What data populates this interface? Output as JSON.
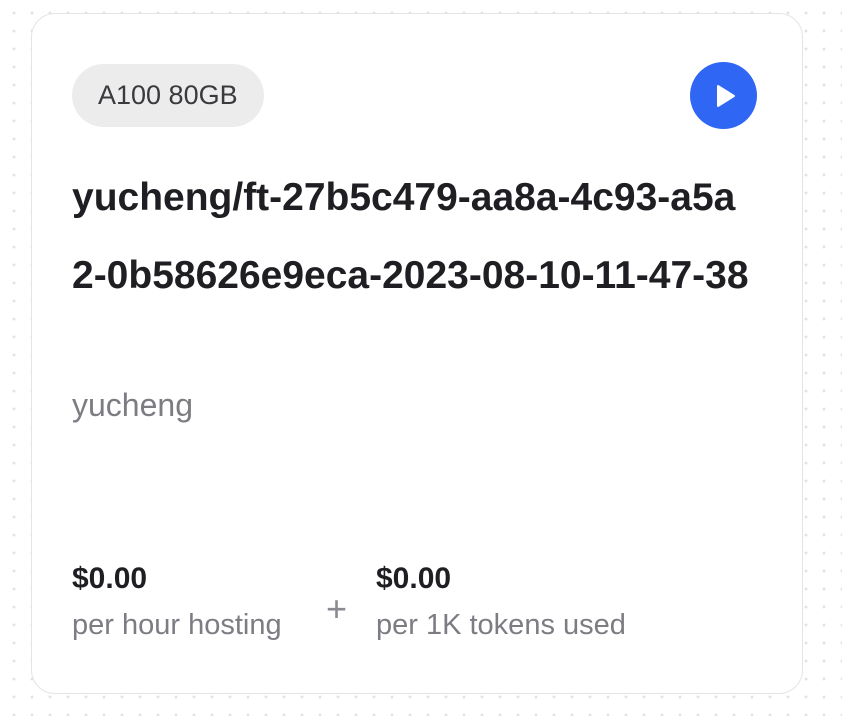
{
  "card": {
    "badge": "A100 80GB",
    "title": "yucheng/ft-27b5c479-aa8a-4c93-a5a2-0b58626e9eca-2023-08-10-11-47-38",
    "owner": "yucheng",
    "play_icon": "play-icon",
    "pricing": {
      "hosting": {
        "amount": "$0.00",
        "description": "per hour hosting"
      },
      "separator": "+",
      "tokens": {
        "amount": "$0.00",
        "description": "per 1K tokens used"
      }
    }
  },
  "colors": {
    "accent": "#2f66f4",
    "badge_bg": "#ececed",
    "title_text": "#1f1f23",
    "muted_text": "#7c7c82"
  }
}
